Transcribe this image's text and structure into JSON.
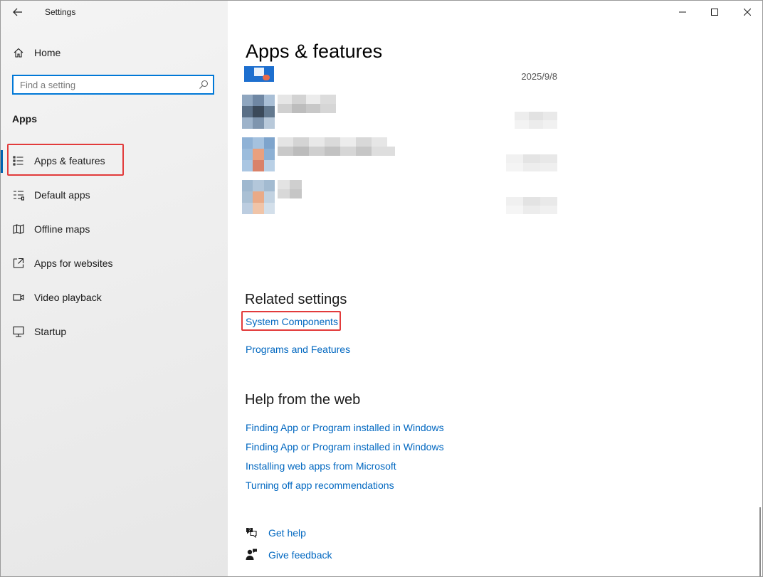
{
  "window": {
    "title": "Settings"
  },
  "titlebar": {
    "back_icon": "arrow-left-icon",
    "minimize_icon": "minimize-icon",
    "maximize_icon": "maximize-icon",
    "close_icon": "close-icon"
  },
  "sidebar": {
    "home_label": "Home",
    "search_placeholder": "Find a setting",
    "section_title": "Apps",
    "items": [
      {
        "label": "Apps & features",
        "icon": "list-icon",
        "selected": true
      },
      {
        "label": "Default apps",
        "icon": "default-apps-icon",
        "selected": false
      },
      {
        "label": "Offline maps",
        "icon": "map-icon",
        "selected": false
      },
      {
        "label": "Apps for websites",
        "icon": "open-website-icon",
        "selected": false
      },
      {
        "label": "Video playback",
        "icon": "video-icon",
        "selected": false
      },
      {
        "label": "Startup",
        "icon": "startup-icon",
        "selected": false
      }
    ]
  },
  "main": {
    "title": "Apps & features",
    "app_list": [
      {
        "date": "2025/9/8",
        "icon": "app-installer-icon"
      }
    ],
    "related_settings": {
      "heading": "Related settings",
      "links": [
        "System Components",
        "Programs and Features"
      ]
    },
    "help": {
      "heading": "Help from the web",
      "links": [
        "Finding App or Program installed in Windows",
        "Finding App or Program installed in Windows",
        "Installing web apps from Microsoft",
        "Turning off app recommendations"
      ]
    },
    "footer": {
      "get_help": "Get help",
      "give_feedback": "Give feedback"
    }
  },
  "colors": {
    "accent": "#0078d7",
    "link": "#0067c0",
    "highlight_box": "#e23b3b"
  }
}
